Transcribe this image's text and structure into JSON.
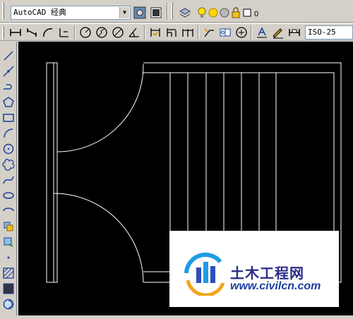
{
  "toolbar_top": {
    "workspace_value": "AutoCAD 经典",
    "layer_value": "0",
    "icons": [
      "workspace-settings-icon",
      "toolbar-customize-icon",
      "layer-manager-icon",
      "lightbulb-icon",
      "sun-icon",
      "freeze-icon",
      "lock-icon",
      "color-swatch-icon"
    ]
  },
  "toolbar_dim": {
    "dimstyle_value": "ISO-25",
    "icons": [
      "linear-dim-icon",
      "aligned-dim-icon",
      "arc-length-icon",
      "ordinate-dim-icon",
      "radius-dim-icon",
      "jogged-dim-icon",
      "diameter-dim-icon",
      "angular-dim-icon",
      "quick-dim-icon",
      "baseline-dim-icon",
      "continue-dim-icon",
      "quick-leader-icon",
      "tolerance-icon",
      "center-mark-icon",
      "dim-edit-icon",
      "dim-text-edit-icon",
      "dim-update-icon"
    ]
  },
  "left_toolbar": {
    "icons": [
      "line-icon",
      "construction-line-icon",
      "polyline-icon",
      "polygon-icon",
      "rectangle-icon",
      "arc-icon",
      "circle-icon",
      "revision-cloud-icon",
      "spline-icon",
      "ellipse-icon",
      "ellipse-arc-icon",
      "insert-block-icon",
      "make-block-icon",
      "point-icon",
      "hatch-icon",
      "gradient-icon",
      "region-icon"
    ]
  },
  "watermark": {
    "title": "土木工程网",
    "url": "www.civilcn.com",
    "logo_colors": [
      "#1e9be6",
      "#2a4fbf",
      "#f2a51a"
    ]
  },
  "colors": {
    "canvas_bg": "#000000",
    "linework": "#ffffff",
    "toolbar_bg": "#d4d0c8"
  }
}
